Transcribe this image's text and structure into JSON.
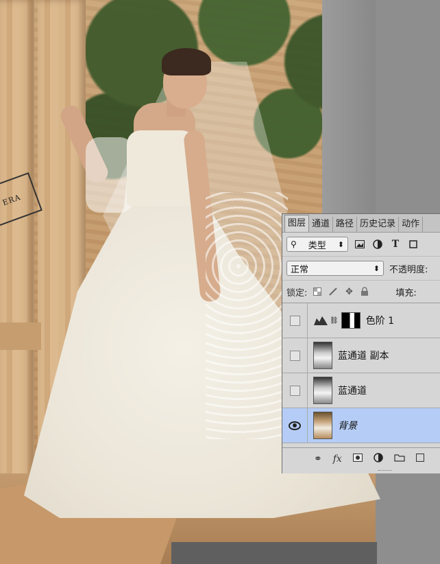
{
  "photo": {
    "stamp_text": "ERA"
  },
  "layers_panel": {
    "tabs": [
      {
        "label": "图层",
        "active": true
      },
      {
        "label": "通道",
        "active": false
      },
      {
        "label": "路径",
        "active": false
      },
      {
        "label": "历史记录",
        "active": false
      },
      {
        "label": "动作",
        "active": false
      }
    ],
    "filter": {
      "kind_label": "类型",
      "kind_arrow": "⬍",
      "icons": [
        "image-filter-icon",
        "adjustment-filter-icon",
        "type-filter-icon",
        "shape-filter-icon"
      ],
      "type_icon_glyph": "T"
    },
    "blend": {
      "mode": "正常",
      "mode_arrow": "⬍",
      "opacity_label": "不透明度:"
    },
    "lock": {
      "label": "锁定:",
      "fill_label": "填充:"
    },
    "layers": [
      {
        "name": "色阶 1",
        "type": "adjustment",
        "visible": false,
        "selected": false
      },
      {
        "name": "蓝通道 副本",
        "type": "pixel-bw",
        "visible": false,
        "selected": false
      },
      {
        "name": "蓝通道",
        "type": "pixel-bw",
        "visible": false,
        "selected": false
      },
      {
        "name": "背景",
        "type": "pixel-color",
        "visible": true,
        "selected": true
      }
    ],
    "footer_icons": [
      "link-layers-icon",
      "fx-icon",
      "add-mask-icon",
      "adjustment-layer-icon",
      "new-group-icon",
      "new-layer-icon"
    ],
    "footer_fx_label": "fx"
  }
}
